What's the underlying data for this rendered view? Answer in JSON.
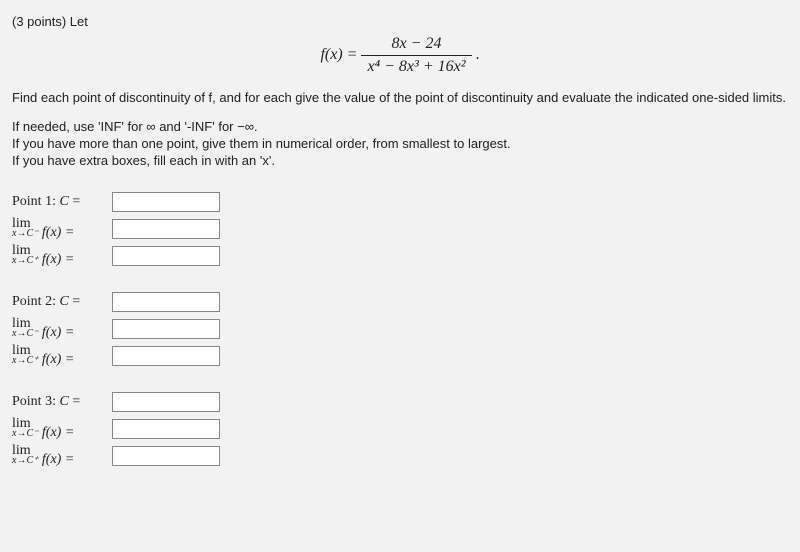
{
  "header": {
    "points": "(3 points) Let"
  },
  "formula": {
    "lhs": "f(x) =",
    "numerator": "8x − 24",
    "denominator": "x⁴ − 8x³ + 16x²",
    "trailing": "."
  },
  "instructions": {
    "main": "Find each point of discontinuity of f, and for each give the value of the point of discontinuity and evaluate the indicated one-sided limits.",
    "line1": "If needed, use 'INF' for ∞ and '-INF' for −∞.",
    "line2": "If you have more than one point, give them in numerical order, from smallest to largest.",
    "line3": "If you have extra boxes, fill each in with an 'x'."
  },
  "points_blocks": [
    {
      "title": "Point 1: C =",
      "lim_left_label_top": "lim",
      "lim_left_label_sub": "x→C⁻",
      "lim_left_fx": "f(x) =",
      "lim_right_label_top": "lim",
      "lim_right_label_sub": "x→C⁺",
      "lim_right_fx": "f(x) ="
    },
    {
      "title": "Point 2: C =",
      "lim_left_label_top": "lim",
      "lim_left_label_sub": "x→C⁻",
      "lim_left_fx": "f(x) =",
      "lim_right_label_top": "lim",
      "lim_right_label_sub": "x→C⁺",
      "lim_right_fx": "f(x) ="
    },
    {
      "title": "Point 3: C =",
      "lim_left_label_top": "lim",
      "lim_left_label_sub": "x→C⁻",
      "lim_left_fx": "f(x) =",
      "lim_right_label_top": "lim",
      "lim_right_label_sub": "x→C⁺",
      "lim_right_fx": "f(x) ="
    }
  ]
}
